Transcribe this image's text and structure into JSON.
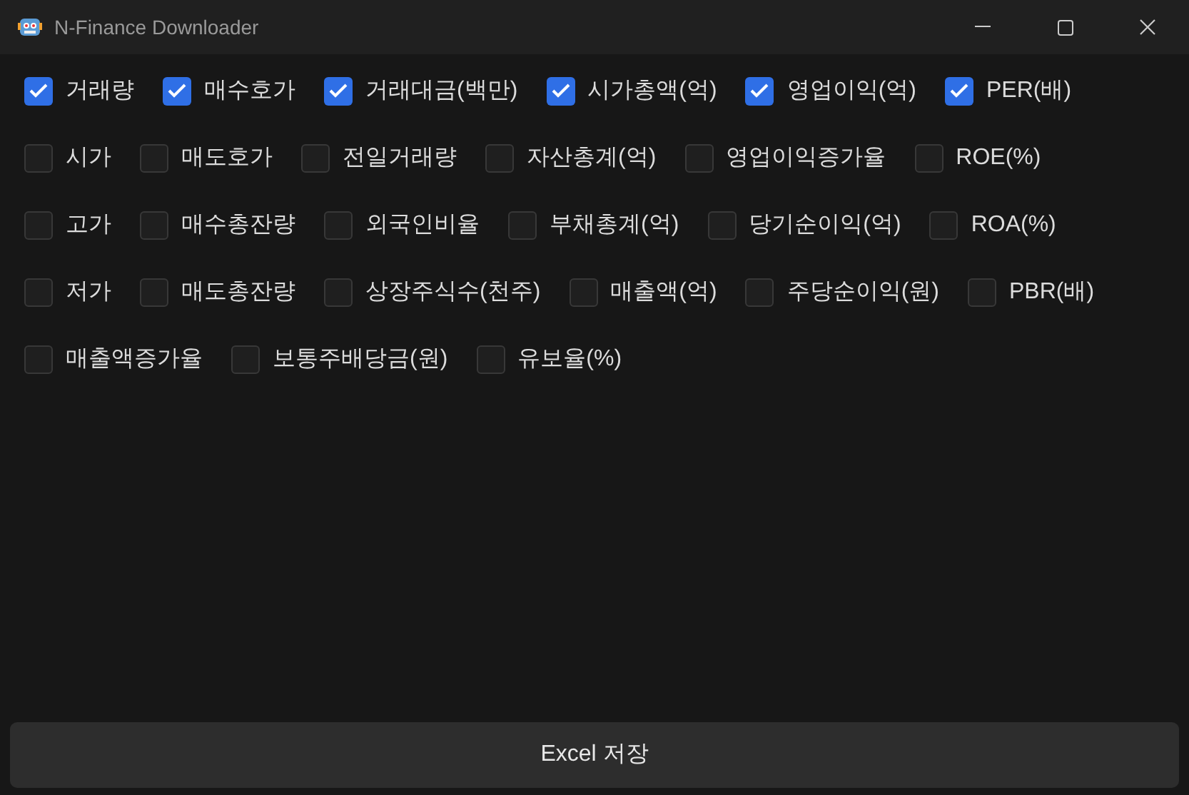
{
  "window": {
    "title": "N-Finance Downloader"
  },
  "option_rows": [
    [
      {
        "label": "거래량",
        "checked": true
      },
      {
        "label": "매수호가",
        "checked": true
      },
      {
        "label": "거래대금(백만)",
        "checked": true
      },
      {
        "label": "시가총액(억)",
        "checked": true
      },
      {
        "label": "영업이익(억)",
        "checked": true
      },
      {
        "label": "PER(배)",
        "checked": true
      }
    ],
    [
      {
        "label": "시가",
        "checked": false
      },
      {
        "label": "매도호가",
        "checked": false
      },
      {
        "label": "전일거래량",
        "checked": false
      },
      {
        "label": "자산총계(억)",
        "checked": false
      },
      {
        "label": "영업이익증가율",
        "checked": false
      },
      {
        "label": "ROE(%)",
        "checked": false
      }
    ],
    [
      {
        "label": "고가",
        "checked": false
      },
      {
        "label": "매수총잔량",
        "checked": false
      },
      {
        "label": "외국인비율",
        "checked": false
      },
      {
        "label": "부채총계(억)",
        "checked": false
      },
      {
        "label": "당기순이익(억)",
        "checked": false
      },
      {
        "label": "ROA(%)",
        "checked": false
      }
    ],
    [
      {
        "label": "저가",
        "checked": false
      },
      {
        "label": "매도총잔량",
        "checked": false
      },
      {
        "label": "상장주식수(천주)",
        "checked": false
      },
      {
        "label": "매출액(억)",
        "checked": false
      },
      {
        "label": "주당순이익(원)",
        "checked": false
      },
      {
        "label": "PBR(배)",
        "checked": false
      }
    ],
    [
      {
        "label": "매출액증가율",
        "checked": false
      },
      {
        "label": "보통주배당금(원)",
        "checked": false
      },
      {
        "label": "유보율(%)",
        "checked": false
      }
    ]
  ],
  "save_button": "Excel 저장"
}
